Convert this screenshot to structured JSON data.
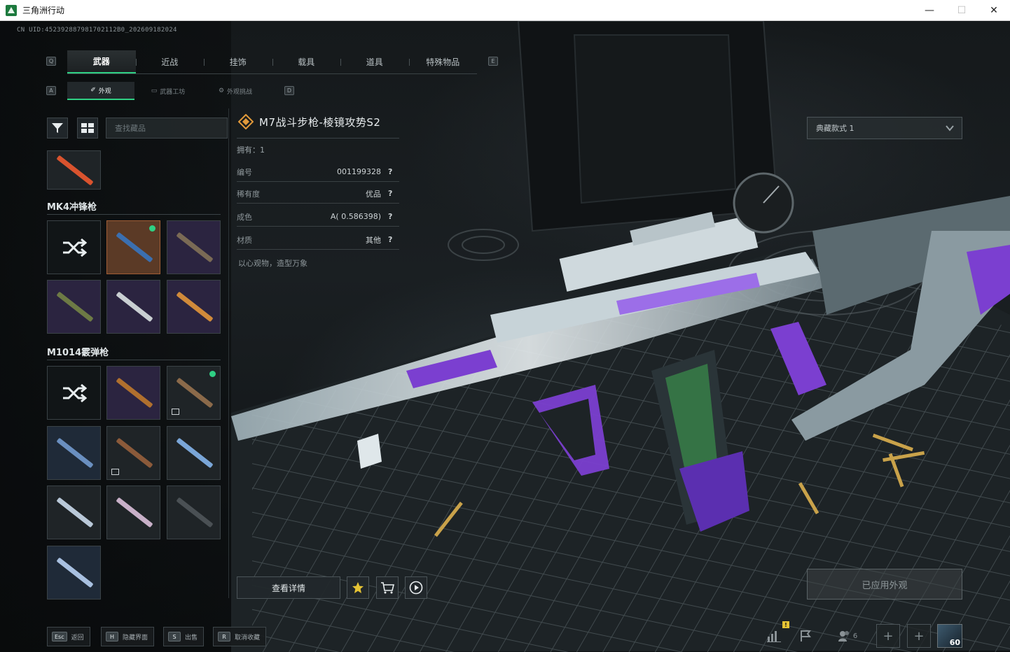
{
  "window": {
    "title": "三角洲行动",
    "min": "—",
    "max": "☐",
    "close": "✕"
  },
  "uid_text": "CN UID:452392887981702112B0_202609182024",
  "keys": {
    "tab_left": "Q",
    "tab_right": "E",
    "sub_left": "A",
    "sub_right": "D"
  },
  "tabs": [
    "武器",
    "近战",
    "挂饰",
    "载具",
    "道具",
    "特殊物品"
  ],
  "subtabs": [
    "外观",
    "武器工坊",
    "外观挑战"
  ],
  "search": {
    "placeholder": "查找藏品"
  },
  "sections": [
    {
      "title": "MK4冲锋枪"
    },
    {
      "title": "M1014霰弹枪"
    }
  ],
  "item": {
    "name": "M7战斗步枪-棱镜攻势S2",
    "owned_label": "拥有：1",
    "attrs": [
      {
        "k": "编号",
        "v": "001199328",
        "q": "?"
      },
      {
        "k": "稀有度",
        "v": "优品",
        "q": "?"
      },
      {
        "k": "成色",
        "v": "A( 0.586398)",
        "q": "?"
      },
      {
        "k": "材质",
        "v": "其他",
        "q": "?"
      }
    ],
    "hint": "以心观物，造型万象"
  },
  "actions": {
    "details": "查看详情"
  },
  "preset": {
    "label": "典藏款式 1"
  },
  "applied": "已应用外观",
  "footer": [
    {
      "key": "Esc",
      "label": "返回"
    },
    {
      "key": "H",
      "label": "隐藏界面"
    },
    {
      "key": "S",
      "label": "出售"
    },
    {
      "key": "R",
      "label": "取消收藏"
    }
  ],
  "hud": {
    "badge": "!",
    "friends": "6",
    "level": "60",
    "plus": "+"
  },
  "colors": {
    "accent": "#2fd084",
    "purple": "#7b3fd0",
    "brass": "#c9a24a"
  }
}
